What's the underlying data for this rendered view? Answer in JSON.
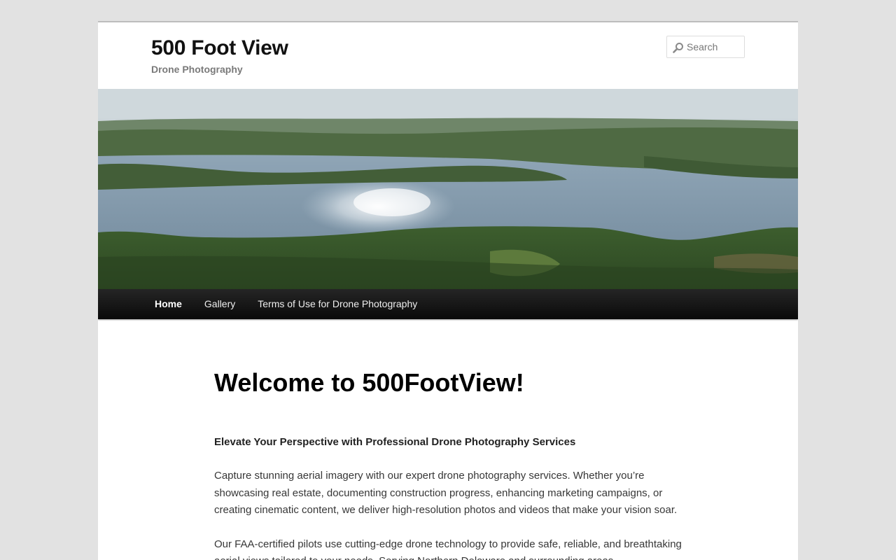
{
  "header": {
    "site_title": "500 Foot View",
    "site_description": "Drone Photography",
    "search": {
      "placeholder": "Search",
      "value": ""
    }
  },
  "nav": {
    "items": [
      {
        "label": "Home",
        "current": true
      },
      {
        "label": "Gallery",
        "current": false
      },
      {
        "label": "Terms of Use for Drone Photography",
        "current": false
      }
    ]
  },
  "content": {
    "title": "Welcome to 500FootView!",
    "lead": "Elevate Your Perspective with Professional Drone Photography Services",
    "paragraphs": [
      "Capture stunning aerial imagery with our expert drone photography services. Whether you’re showcasing real estate, documenting construction progress, enhancing marketing campaigns, or creating cinematic content, we deliver high-resolution photos and videos that make your vision soar.",
      "Our FAA-certified pilots use cutting-edge drone technology to provide safe, reliable, and breathtaking aerial views tailored to your needs. Serving Northern Delaware and surrounding areas,"
    ]
  },
  "icons": {
    "search": "magnifier-icon"
  },
  "colors": {
    "page_bg": "#e2e2e2",
    "nav_bg": "#1a1a1a",
    "title": "#111111"
  }
}
